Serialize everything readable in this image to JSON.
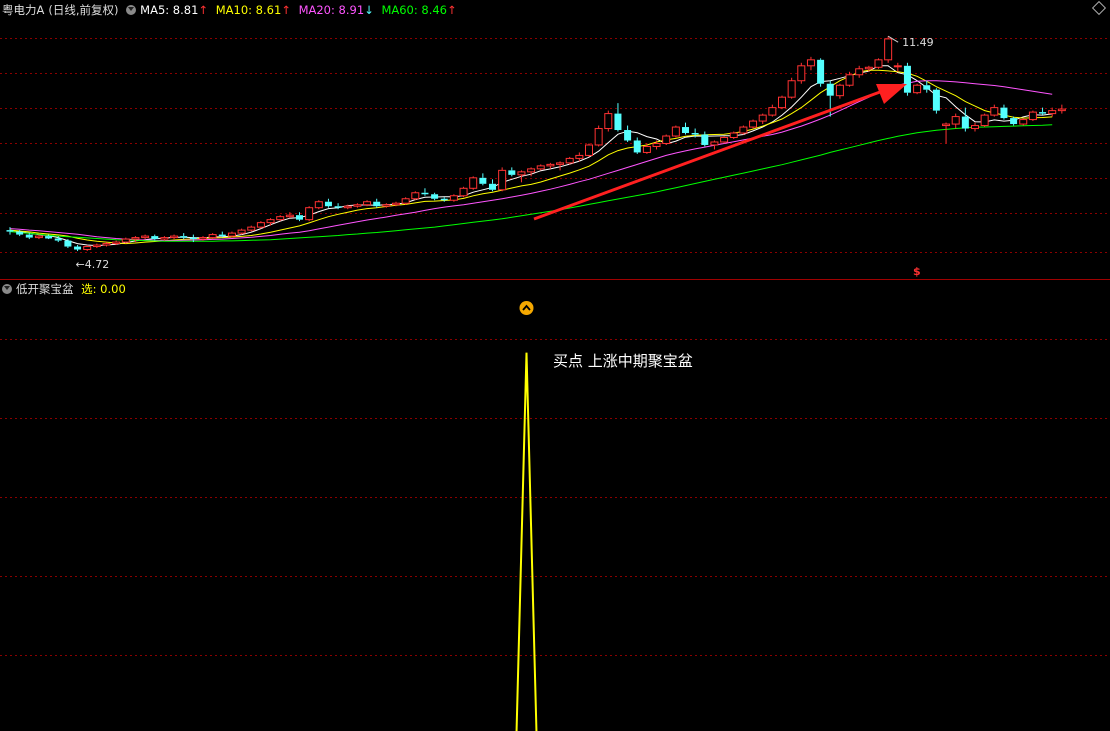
{
  "header": {
    "stock_title": "粤电力A",
    "period": "(日线,前复权)",
    "ma5_label": "MA5: 8.81",
    "ma5_arrow": "↑",
    "ma10_label": "MA10: 8.61",
    "ma10_arrow": "↑",
    "ma20_label": "MA20: 8.91",
    "ma20_arrow": "↓",
    "ma60_label": "MA60: 8.46",
    "ma60_arrow": "↑"
  },
  "indicator": {
    "name": "低开聚宝盆",
    "select_label": "选: 0.00"
  },
  "annotation": "买点 上涨中期聚宝盆",
  "colors": {
    "up": "#ff3232",
    "down": "#54ffff",
    "ma5": "#ffffff",
    "ma10": "#ffff00",
    "ma20": "#ff55ff",
    "ma60": "#00ff00",
    "grid": "#8b0000",
    "indicator_line": "#ffff00",
    "arrow": "#ff2020"
  },
  "chart_data": [
    {
      "type": "candlestick",
      "title": "粤电力A",
      "ylim": [
        4.1,
        12.1
      ],
      "high_label": "11.49",
      "low_label": "4.72",
      "candles": [
        [
          5.0,
          5.1,
          4.85,
          4.95
        ],
        [
          4.95,
          5.0,
          4.8,
          4.85
        ],
        [
          4.85,
          4.9,
          4.7,
          4.75
        ],
        [
          4.75,
          4.85,
          4.7,
          4.8
        ],
        [
          4.8,
          4.85,
          4.7,
          4.72
        ],
        [
          4.72,
          4.8,
          4.6,
          4.65
        ],
        [
          4.65,
          4.7,
          4.4,
          4.45
        ],
        [
          4.45,
          4.5,
          4.3,
          4.35
        ],
        [
          4.35,
          4.5,
          4.3,
          4.45
        ],
        [
          4.45,
          4.55,
          4.4,
          4.5
        ],
        [
          4.5,
          4.6,
          4.45,
          4.55
        ],
        [
          4.55,
          4.65,
          4.5,
          4.6
        ],
        [
          4.6,
          4.75,
          4.55,
          4.7
        ],
        [
          4.7,
          4.8,
          4.6,
          4.75
        ],
        [
          4.75,
          4.85,
          4.7,
          4.8
        ],
        [
          4.8,
          4.85,
          4.65,
          4.7
        ],
        [
          4.7,
          4.8,
          4.65,
          4.75
        ],
        [
          4.75,
          4.85,
          4.7,
          4.8
        ],
        [
          4.8,
          4.9,
          4.7,
          4.75
        ],
        [
          4.75,
          4.85,
          4.6,
          4.7
        ],
        [
          4.7,
          4.8,
          4.65,
          4.75
        ],
        [
          4.75,
          4.9,
          4.7,
          4.85
        ],
        [
          4.85,
          4.95,
          4.75,
          4.8
        ],
        [
          4.8,
          4.95,
          4.75,
          4.9
        ],
        [
          4.9,
          5.05,
          4.85,
          5.0
        ],
        [
          5.0,
          5.15,
          4.95,
          5.1
        ],
        [
          5.1,
          5.3,
          5.05,
          5.25
        ],
        [
          5.25,
          5.4,
          5.15,
          5.35
        ],
        [
          5.35,
          5.5,
          5.3,
          5.45
        ],
        [
          5.45,
          5.6,
          5.4,
          5.5
        ],
        [
          5.5,
          5.6,
          5.3,
          5.35
        ],
        [
          5.35,
          5.8,
          5.3,
          5.75
        ],
        [
          5.75,
          6.0,
          5.7,
          5.95
        ],
        [
          5.95,
          6.05,
          5.75,
          5.8
        ],
        [
          5.8,
          5.9,
          5.7,
          5.75
        ],
        [
          5.75,
          5.85,
          5.7,
          5.8
        ],
        [
          5.8,
          5.9,
          5.75,
          5.85
        ],
        [
          5.85,
          6.0,
          5.8,
          5.95
        ],
        [
          5.95,
          6.05,
          5.75,
          5.8
        ],
        [
          5.8,
          5.9,
          5.75,
          5.85
        ],
        [
          5.85,
          5.95,
          5.8,
          5.9
        ],
        [
          5.9,
          6.1,
          5.85,
          6.05
        ],
        [
          6.05,
          6.3,
          6.0,
          6.25
        ],
        [
          6.25,
          6.4,
          6.15,
          6.2
        ],
        [
          6.2,
          6.25,
          6.0,
          6.05
        ],
        [
          6.05,
          6.1,
          5.95,
          6.0
        ],
        [
          6.0,
          6.2,
          5.95,
          6.15
        ],
        [
          6.15,
          6.45,
          6.1,
          6.4
        ],
        [
          6.4,
          6.8,
          6.35,
          6.75
        ],
        [
          6.75,
          6.9,
          6.5,
          6.55
        ],
        [
          6.55,
          6.7,
          6.3,
          6.35
        ],
        [
          6.35,
          7.1,
          6.3,
          7.0
        ],
        [
          7.0,
          7.1,
          6.8,
          6.85
        ],
        [
          6.85,
          7.0,
          6.6,
          6.95
        ],
        [
          6.95,
          7.1,
          6.8,
          7.05
        ],
        [
          7.05,
          7.2,
          7.0,
          7.15
        ],
        [
          7.15,
          7.25,
          7.05,
          7.2
        ],
        [
          7.2,
          7.3,
          7.0,
          7.25
        ],
        [
          7.25,
          7.45,
          7.2,
          7.4
        ],
        [
          7.4,
          7.6,
          7.3,
          7.5
        ],
        [
          7.5,
          7.9,
          7.45,
          7.85
        ],
        [
          7.85,
          8.5,
          7.8,
          8.4
        ],
        [
          8.4,
          9.0,
          8.3,
          8.9
        ],
        [
          8.9,
          9.25,
          8.3,
          8.35
        ],
        [
          8.35,
          8.5,
          7.95,
          8.0
        ],
        [
          8.0,
          8.1,
          7.55,
          7.6
        ],
        [
          7.6,
          7.9,
          7.55,
          7.8
        ],
        [
          7.8,
          8.0,
          7.7,
          7.9
        ],
        [
          7.9,
          8.2,
          7.85,
          8.15
        ],
        [
          8.15,
          8.5,
          8.1,
          8.45
        ],
        [
          8.45,
          8.6,
          8.2,
          8.25
        ],
        [
          8.25,
          8.4,
          8.1,
          8.2
        ],
        [
          8.2,
          8.3,
          7.8,
          7.85
        ],
        [
          7.85,
          8.0,
          7.7,
          7.95
        ],
        [
          7.95,
          8.15,
          7.9,
          8.1
        ],
        [
          8.1,
          8.3,
          8.05,
          8.25
        ],
        [
          8.25,
          8.5,
          8.2,
          8.45
        ],
        [
          8.45,
          8.7,
          8.4,
          8.65
        ],
        [
          8.65,
          8.9,
          8.55,
          8.85
        ],
        [
          8.85,
          9.2,
          8.8,
          9.1
        ],
        [
          9.1,
          9.5,
          9.05,
          9.45
        ],
        [
          9.45,
          10.1,
          9.4,
          10.0
        ],
        [
          10.0,
          10.6,
          9.9,
          10.5
        ],
        [
          10.5,
          10.8,
          10.35,
          10.7
        ],
        [
          10.7,
          10.75,
          9.8,
          9.9
        ],
        [
          9.9,
          10.0,
          8.8,
          9.5
        ],
        [
          9.5,
          9.9,
          9.4,
          9.85
        ],
        [
          9.85,
          10.3,
          9.8,
          10.2
        ],
        [
          10.2,
          10.5,
          10.1,
          10.4
        ],
        [
          10.4,
          10.5,
          10.3,
          10.45
        ],
        [
          10.45,
          10.75,
          10.4,
          10.7
        ],
        [
          10.7,
          11.49,
          10.6,
          11.4
        ],
        [
          10.5,
          10.6,
          10.3,
          10.5
        ],
        [
          10.5,
          10.6,
          9.5,
          9.6
        ],
        [
          9.6,
          9.9,
          9.55,
          9.85
        ],
        [
          9.85,
          10.0,
          9.6,
          9.7
        ],
        [
          9.7,
          9.75,
          8.9,
          9.0
        ],
        [
          8.5,
          8.6,
          7.9,
          8.55
        ],
        [
          8.55,
          8.9,
          8.4,
          8.8
        ],
        [
          8.8,
          9.1,
          8.3,
          8.4
        ],
        [
          8.4,
          8.6,
          8.3,
          8.5
        ],
        [
          8.5,
          8.9,
          8.45,
          8.85
        ],
        [
          8.85,
          9.2,
          8.8,
          9.1
        ],
        [
          9.1,
          9.2,
          8.7,
          8.75
        ],
        [
          8.75,
          8.8,
          8.5,
          8.55
        ],
        [
          8.55,
          8.75,
          8.5,
          8.7
        ],
        [
          8.7,
          9.0,
          8.65,
          8.95
        ],
        [
          8.95,
          9.1,
          8.85,
          8.9
        ],
        [
          8.9,
          9.1,
          8.8,
          9.0
        ],
        [
          9.0,
          9.2,
          8.9,
          9.05
        ]
      ],
      "series": [
        {
          "name": "MA5",
          "values": [
            5.0,
            4.95,
            4.9,
            4.85,
            4.82,
            4.75,
            4.65,
            4.55,
            4.5,
            4.48,
            4.5,
            4.53,
            4.58,
            4.64,
            4.68,
            4.72,
            4.73,
            4.76,
            4.76,
            4.75,
            4.74,
            4.77,
            4.78,
            4.8,
            4.85,
            4.93,
            5.05,
            5.18,
            5.3,
            5.4,
            5.42,
            5.5,
            5.62,
            5.72,
            5.75,
            5.82,
            5.84,
            5.84,
            5.83,
            5.85,
            5.87,
            5.91,
            6.02,
            6.1,
            6.11,
            6.12,
            6.12,
            6.15,
            6.27,
            6.35,
            6.43,
            6.6,
            6.7,
            6.8,
            6.87,
            6.99,
            7.05,
            7.12,
            7.21,
            7.31,
            7.44,
            7.64,
            7.93,
            8.21,
            8.31,
            8.26,
            8.13,
            8.05,
            7.89,
            7.98,
            8.11,
            8.15,
            8.14,
            8.15,
            8.16,
            8.16,
            8.2,
            8.32,
            8.45,
            8.62,
            8.85,
            9.12,
            9.45,
            9.8,
            9.97,
            10.0,
            10.08,
            10.17,
            10.26,
            10.32,
            10.5,
            10.5,
            10.27,
            10.2,
            10.0,
            9.77,
            9.51,
            9.43,
            9.13,
            8.86,
            8.63,
            8.62,
            8.69,
            8.65,
            8.68,
            8.79,
            8.86,
            8.85,
            8.89
          ]
        },
        {
          "name": "MA10",
          "values": [
            5.0,
            4.97,
            4.94,
            4.9,
            4.87,
            4.84,
            4.8,
            4.73,
            4.67,
            4.63,
            4.6,
            4.57,
            4.55,
            4.57,
            4.6,
            4.62,
            4.64,
            4.67,
            4.69,
            4.71,
            4.72,
            4.74,
            4.75,
            4.77,
            4.79,
            4.82,
            4.87,
            4.93,
            5.0,
            5.07,
            5.14,
            5.24,
            5.35,
            5.45,
            5.53,
            5.6,
            5.67,
            5.72,
            5.75,
            5.79,
            5.83,
            5.86,
            5.91,
            5.96,
            5.97,
            5.99,
            6.01,
            6.06,
            6.15,
            6.22,
            6.27,
            6.34,
            6.41,
            6.48,
            6.53,
            6.61,
            6.71,
            6.81,
            6.91,
            7.02,
            7.14,
            7.32,
            7.52,
            7.66,
            7.75,
            7.8,
            7.85,
            7.95,
            8.02,
            8.07,
            8.14,
            8.17,
            8.19,
            8.2,
            8.21,
            8.25,
            8.3,
            8.38,
            8.48,
            8.6,
            8.72,
            8.9,
            9.1,
            9.35,
            9.6,
            9.8,
            10.0,
            10.15,
            10.3,
            10.35,
            10.35,
            10.33,
            10.3,
            10.25,
            10.15,
            9.98,
            9.8,
            9.65,
            9.5,
            9.3,
            9.15,
            9.0,
            8.92,
            8.85,
            8.78,
            8.75,
            8.76,
            8.77,
            8.79
          ]
        },
        {
          "name": "MA20",
          "values": [
            5.05,
            5.03,
            5.0,
            4.98,
            4.95,
            4.92,
            4.89,
            4.86,
            4.82,
            4.78,
            4.75,
            4.72,
            4.7,
            4.68,
            4.67,
            4.66,
            4.65,
            4.65,
            4.66,
            4.67,
            4.68,
            4.69,
            4.7,
            4.72,
            4.74,
            4.76,
            4.79,
            4.82,
            4.86,
            4.9,
            4.93,
            4.98,
            5.04,
            5.1,
            5.16,
            5.22,
            5.28,
            5.34,
            5.39,
            5.44,
            5.5,
            5.55,
            5.6,
            5.66,
            5.72,
            5.77,
            5.81,
            5.85,
            5.9,
            5.95,
            6.0,
            6.05,
            6.11,
            6.17,
            6.23,
            6.3,
            6.37,
            6.45,
            6.53,
            6.62,
            6.7,
            6.8,
            6.9,
            7.0,
            7.1,
            7.2,
            7.3,
            7.4,
            7.5,
            7.58,
            7.65,
            7.72,
            7.78,
            7.84,
            7.9,
            7.96,
            8.02,
            8.08,
            8.14,
            8.2,
            8.28,
            8.38,
            8.48,
            8.6,
            8.72,
            8.85,
            9.0,
            9.15,
            9.3,
            9.45,
            9.6,
            9.75,
            9.85,
            9.92,
            9.98,
            10.0,
            10.0,
            9.98,
            9.96,
            9.93,
            9.9,
            9.87,
            9.84,
            9.8,
            9.75,
            9.7,
            9.65,
            9.6,
            9.55
          ]
        },
        {
          "name": "MA60",
          "values": [
            4.95,
            4.92,
            4.89,
            4.86,
            4.83,
            4.8,
            4.78,
            4.76,
            4.74,
            4.72,
            4.7,
            4.68,
            4.67,
            4.66,
            4.65,
            4.64,
            4.63,
            4.63,
            4.63,
            4.63,
            4.63,
            4.63,
            4.64,
            4.64,
            4.65,
            4.66,
            4.67,
            4.68,
            4.7,
            4.72,
            4.74,
            4.76,
            4.78,
            4.8,
            4.82,
            4.85,
            4.87,
            4.9,
            4.92,
            4.95,
            4.98,
            5.01,
            5.04,
            5.07,
            5.1,
            5.14,
            5.18,
            5.22,
            5.26,
            5.3,
            5.34,
            5.38,
            5.43,
            5.48,
            5.53,
            5.58,
            5.63,
            5.68,
            5.74,
            5.8,
            5.86,
            5.92,
            5.98,
            6.04,
            6.1,
            6.16,
            6.22,
            6.28,
            6.35,
            6.42,
            6.49,
            6.56,
            6.63,
            6.7,
            6.77,
            6.84,
            6.91,
            6.98,
            7.05,
            7.12,
            7.19,
            7.27,
            7.35,
            7.43,
            7.51,
            7.6,
            7.68,
            7.76,
            7.84,
            7.92,
            8.0,
            8.07,
            8.14,
            8.2,
            8.26,
            8.3,
            8.34,
            8.37,
            8.4,
            8.42,
            8.44,
            8.45,
            8.46,
            8.47,
            8.48,
            8.49,
            8.5,
            8.51,
            8.53
          ]
        }
      ]
    },
    {
      "type": "line",
      "title": "低开聚宝盆",
      "series": [
        {
          "name": "选",
          "values": [
            0,
            0,
            0,
            0,
            0,
            0,
            0,
            0,
            0,
            0,
            0,
            0,
            0,
            0,
            0,
            0,
            0,
            0,
            0,
            0,
            0,
            0,
            0,
            0,
            0,
            0,
            0,
            0,
            0,
            0,
            0,
            0,
            0,
            0,
            0,
            0,
            0,
            0,
            0,
            0,
            0,
            0,
            0,
            0,
            0,
            0,
            0,
            0,
            0,
            0,
            0,
            0,
            0,
            0,
            0,
            0,
            0,
            0,
            0,
            0,
            0,
            0,
            0,
            0,
            0,
            0,
            0,
            0,
            0,
            0,
            0,
            0,
            0,
            0,
            0,
            0,
            0,
            0,
            0,
            0,
            0,
            0,
            0,
            0,
            0,
            0,
            0,
            0,
            0,
            0,
            0,
            0,
            0,
            0,
            0,
            0,
            0,
            0,
            0,
            0,
            0,
            0,
            0,
            0,
            0,
            0,
            0,
            0,
            0
          ]
        }
      ],
      "spike_index": 49,
      "spike_value": 1,
      "ylim": [
        0,
        1.15
      ]
    }
  ]
}
